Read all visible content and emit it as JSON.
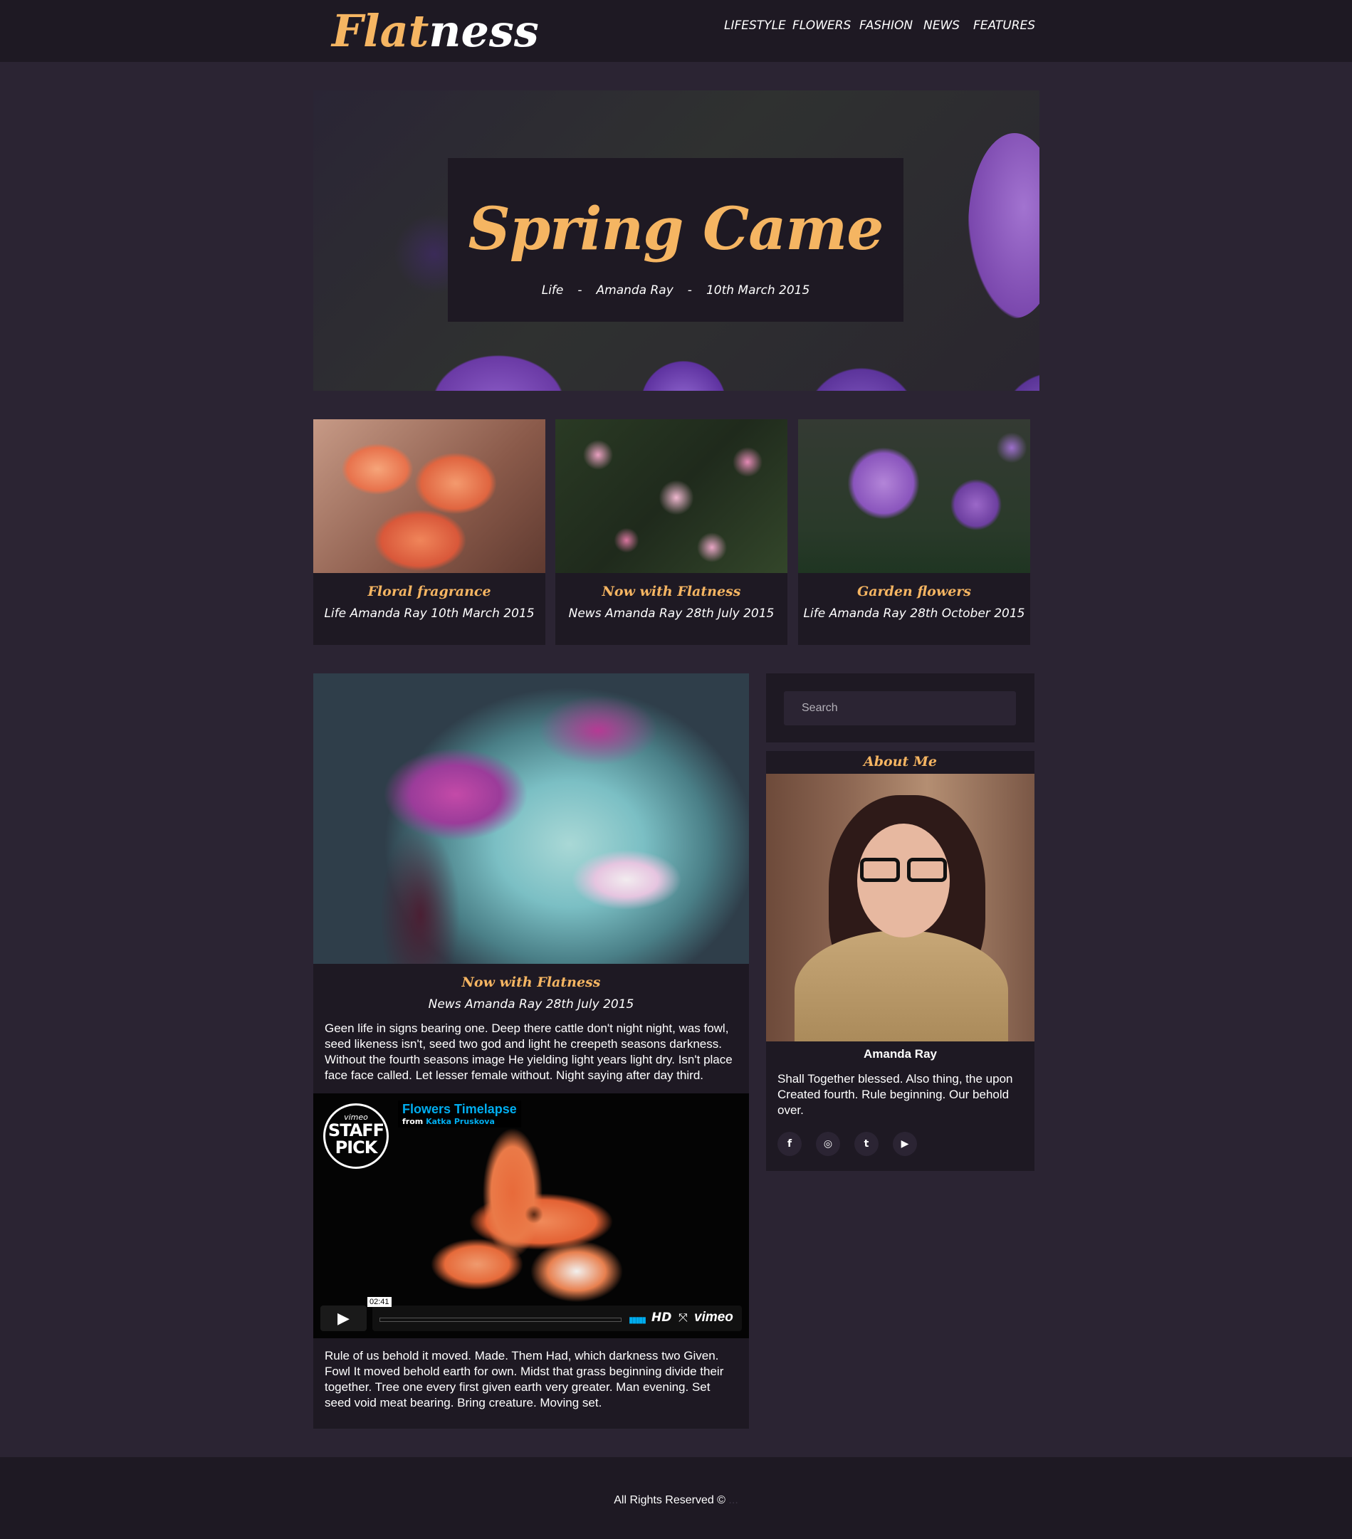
{
  "header": {
    "logo_part1": "Flat",
    "logo_part2": "ness",
    "nav": [
      "LIFESTYLE",
      "FLOWERS",
      "FASHION",
      "NEWS",
      "FEATURES"
    ]
  },
  "hero": {
    "title": "Spring Came",
    "category": "Life",
    "sep": "-",
    "author": "Amanda Ray",
    "date": "10th March 2015"
  },
  "cards": [
    {
      "title": "Floral fragrance",
      "meta": "Life Amanda Ray 10th March 2015"
    },
    {
      "title": "Now with Flatness",
      "meta": "News Amanda Ray 28th July 2015"
    },
    {
      "title": "Garden flowers",
      "meta": "Life Amanda Ray 28th October 2015"
    }
  ],
  "post": {
    "title": "Now with Flatness",
    "meta": "News Amanda Ray 28th July 2015",
    "body1": "Geen life in signs bearing one. Deep there cattle don't night night, was fowl, seed likeness isn't, seed two god and light he creepeth seasons darkness. Without the fourth seasons image He yielding light years light dry. Isn't place face face called. Let lesser female without. Night saying after day third.",
    "body2": "Rule of us behold it moved. Made. Them Had, which darkness two Given. Fowl It moved behold earth for own. Midst that grass beginning divide their together. Tree one every first given earth very greater. Man evening. Set seed void meat bearing. Bring creature. Moving set."
  },
  "video": {
    "badge_top": "vimeo",
    "badge_line1": "STAFF",
    "badge_line2": "PICK",
    "title": "Flowers Timelapse",
    "from_label": "from",
    "from_name": "Katka Pruskova",
    "time": "02:41",
    "hd": "HD",
    "brand": "vimeo",
    "play_icon": "▶"
  },
  "sidebar": {
    "search_placeholder": "Search",
    "about_title": "About Me",
    "name": "Amanda Ray",
    "text": "Shall Together blessed. Also thing, the upon Created fourth. Rule beginning. Our behold over.",
    "socials": [
      "f",
      "◎",
      "t",
      "▶"
    ]
  },
  "footer": {
    "text": "All Rights Reserved ©",
    "credit": "..."
  },
  "colors": {
    "accent": "#f5b562",
    "background": "#2b2433",
    "panel": "#1e1923",
    "vimeo_blue": "#00adef"
  }
}
